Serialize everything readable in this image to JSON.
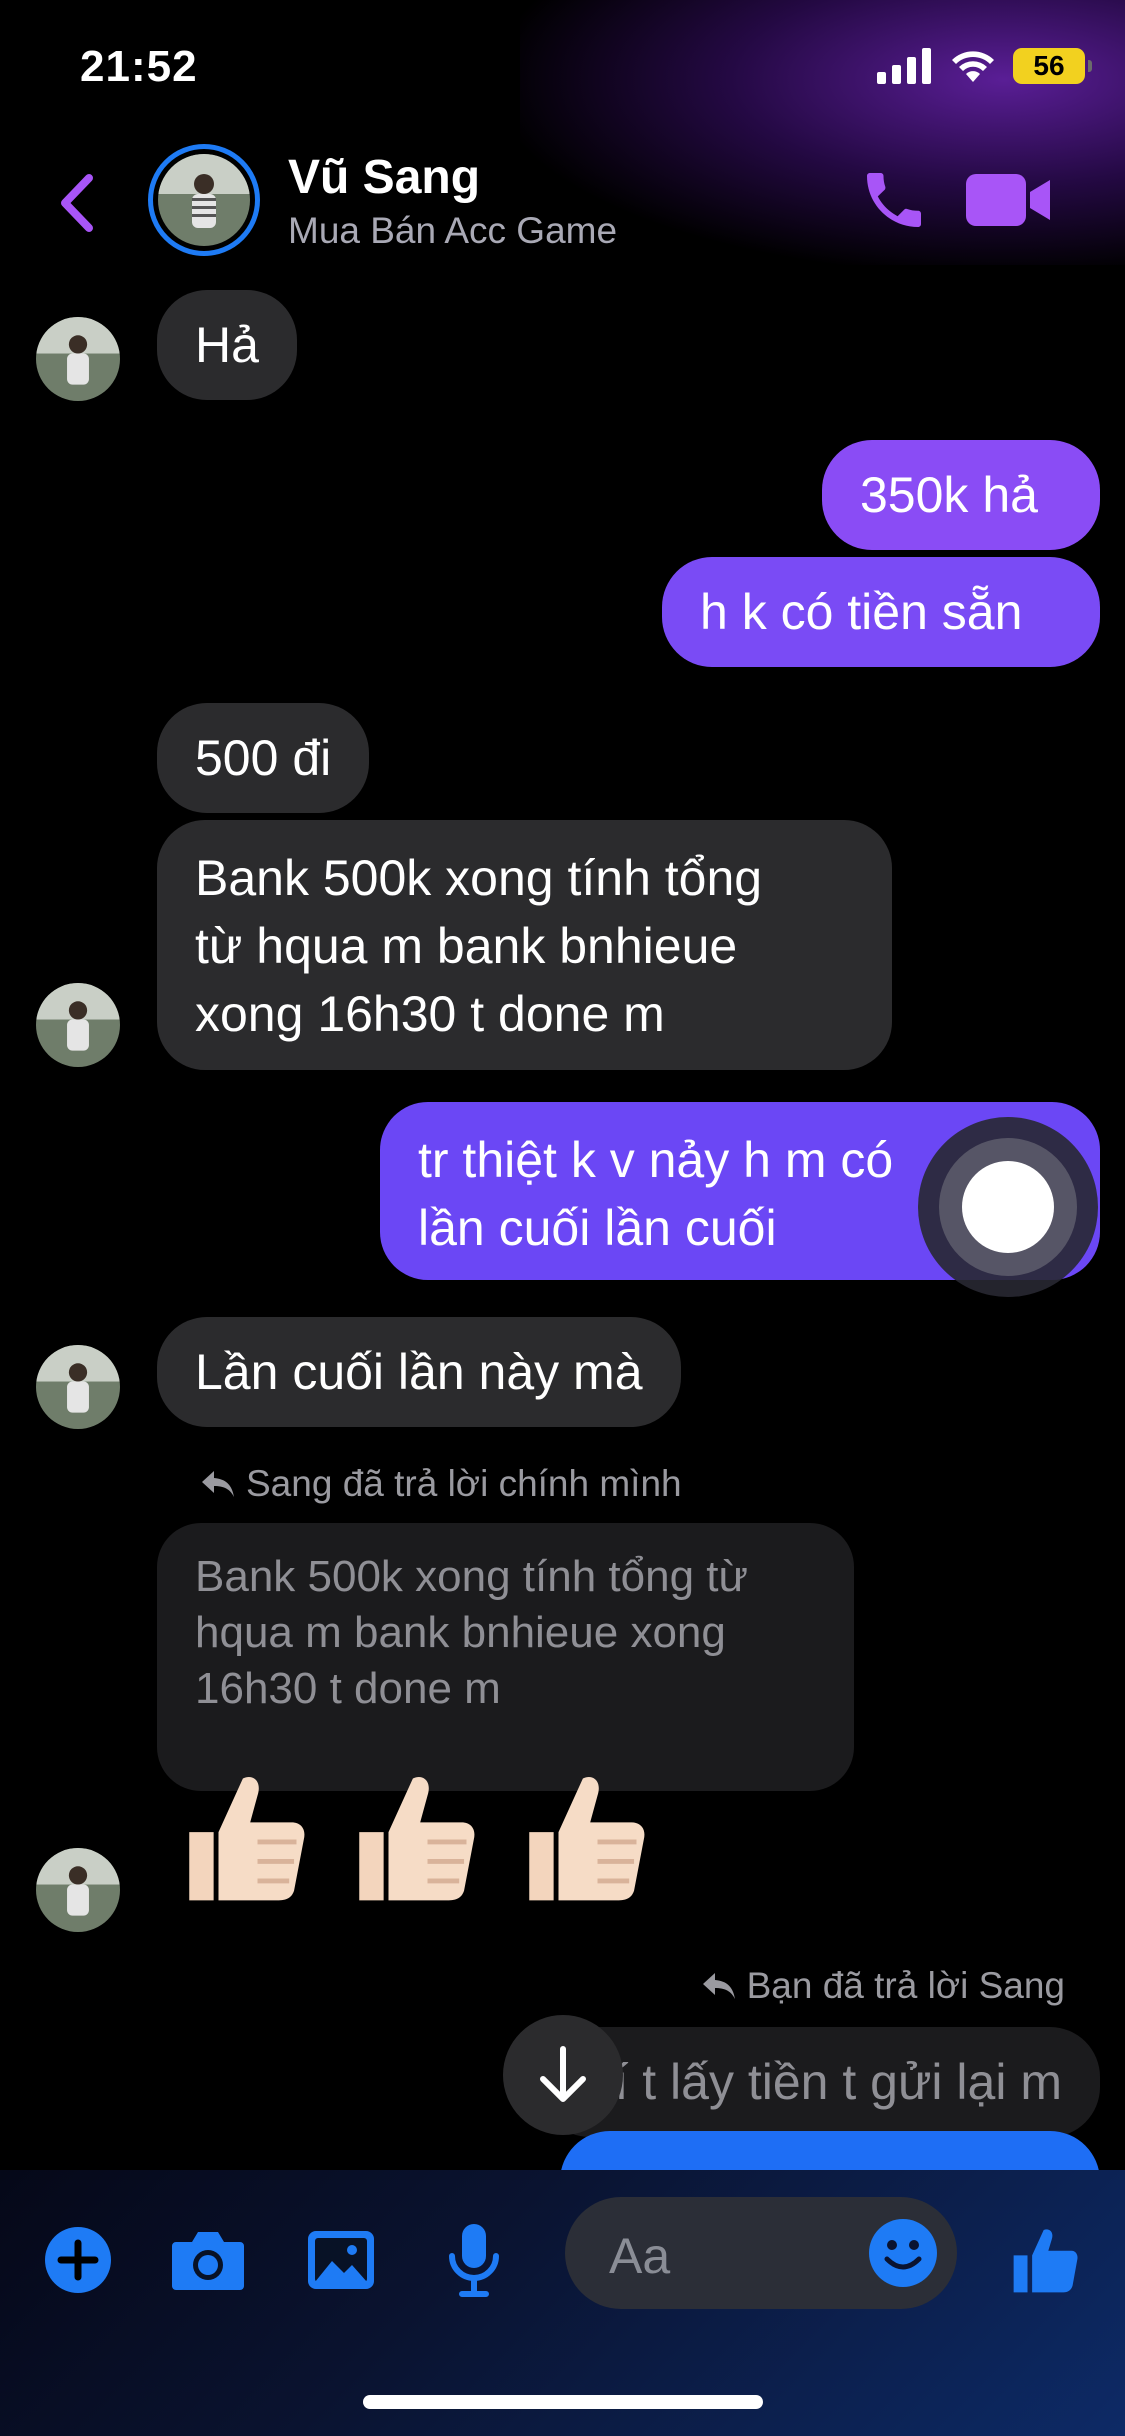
{
  "status": {
    "time": "21:52",
    "battery": "56"
  },
  "header": {
    "name": "Vũ Sang",
    "subtitle": "Mua Bán Acc Game"
  },
  "messages": {
    "m1": "Hả",
    "m2": "350k hả",
    "m3": "h k có tiền sẵn",
    "m4": "500 đi",
    "m5_l1": "Bank 500k xong tính tổng",
    "m5_l2": "từ hqua m bank bnhieue",
    "m5_l3": "xong 16h30 t done m",
    "m6_l1": "tr thiệt k v nảy h m có",
    "m6_l2": "lần cuối lần cuối",
    "m7": "Lần cuối lần này mà",
    "reply1_note": "Sang đã trả lời chính mình",
    "quote1_l1": "Bank 500k xong tính tổng từ",
    "quote1_l2": "hqua m bank bnhieue xong",
    "quote1_l3": "16h30 t done m",
    "reply2_note": "Bạn đã trả lời Sang",
    "quote2": "Tí t lấy tiền t gửi lại m"
  },
  "composer": {
    "placeholder": "Aa"
  },
  "colors": {
    "accent": "#a855f7",
    "outgoing": "#6b47f5",
    "incoming": "#2b2b2d",
    "blue": "#1e7bf5"
  }
}
